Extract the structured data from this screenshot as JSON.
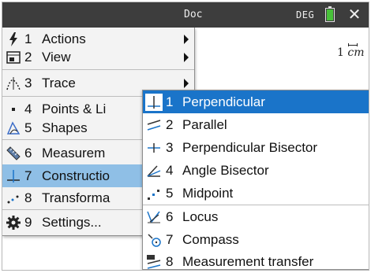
{
  "statusbar": {
    "doc_name": "Doc",
    "angle_mode": "DEG",
    "battery_icon": "battery-icon",
    "close_symbol": "✕"
  },
  "canvas": {
    "scale_value": "1",
    "scale_unit": "cm"
  },
  "main_menu": {
    "items": [
      {
        "num": "1",
        "label": "Actions",
        "icon": "lightning-icon",
        "has_submenu": true
      },
      {
        "num": "2",
        "label": "View",
        "icon": "view-icon",
        "has_submenu": true
      },
      {
        "num": "3",
        "label": "Trace",
        "icon": "trace-icon",
        "has_submenu": true
      },
      {
        "num": "4",
        "label": "Points & Li",
        "icon": "point-icon",
        "has_submenu": true
      },
      {
        "num": "5",
        "label": "Shapes",
        "icon": "shapes-icon",
        "has_submenu": true
      },
      {
        "num": "6",
        "label": "Measurem",
        "icon": "ruler-icon",
        "has_submenu": true
      },
      {
        "num": "7",
        "label": "Constructio",
        "icon": "construction-icon",
        "has_submenu": true,
        "selected": true
      },
      {
        "num": "8",
        "label": "Transforma",
        "icon": "transform-icon",
        "has_submenu": true
      },
      {
        "num": "9",
        "label": "Settings...",
        "icon": "gear-icon",
        "has_submenu": false
      }
    ]
  },
  "sub_menu": {
    "items": [
      {
        "num": "1",
        "label": "Perpendicular",
        "icon": "perpendicular-icon",
        "highlighted": true
      },
      {
        "num": "2",
        "label": "Parallel",
        "icon": "parallel-icon"
      },
      {
        "num": "3",
        "label": "Perpendicular Bisector",
        "icon": "perpendicular-bisector-icon"
      },
      {
        "num": "4",
        "label": "Angle Bisector",
        "icon": "angle-bisector-icon"
      },
      {
        "num": "5",
        "label": "Midpoint",
        "icon": "midpoint-icon"
      },
      {
        "num": "6",
        "label": "Locus",
        "icon": "locus-icon"
      },
      {
        "num": "7",
        "label": "Compass",
        "icon": "compass-icon"
      },
      {
        "num": "8",
        "label": "Measurement transfer",
        "icon": "measurement-transfer-icon"
      }
    ]
  },
  "colors": {
    "titlebar": "#3d3d3d",
    "highlight": "#1a74c9",
    "selected": "#8fbfe6",
    "battery": "#48c13a"
  }
}
